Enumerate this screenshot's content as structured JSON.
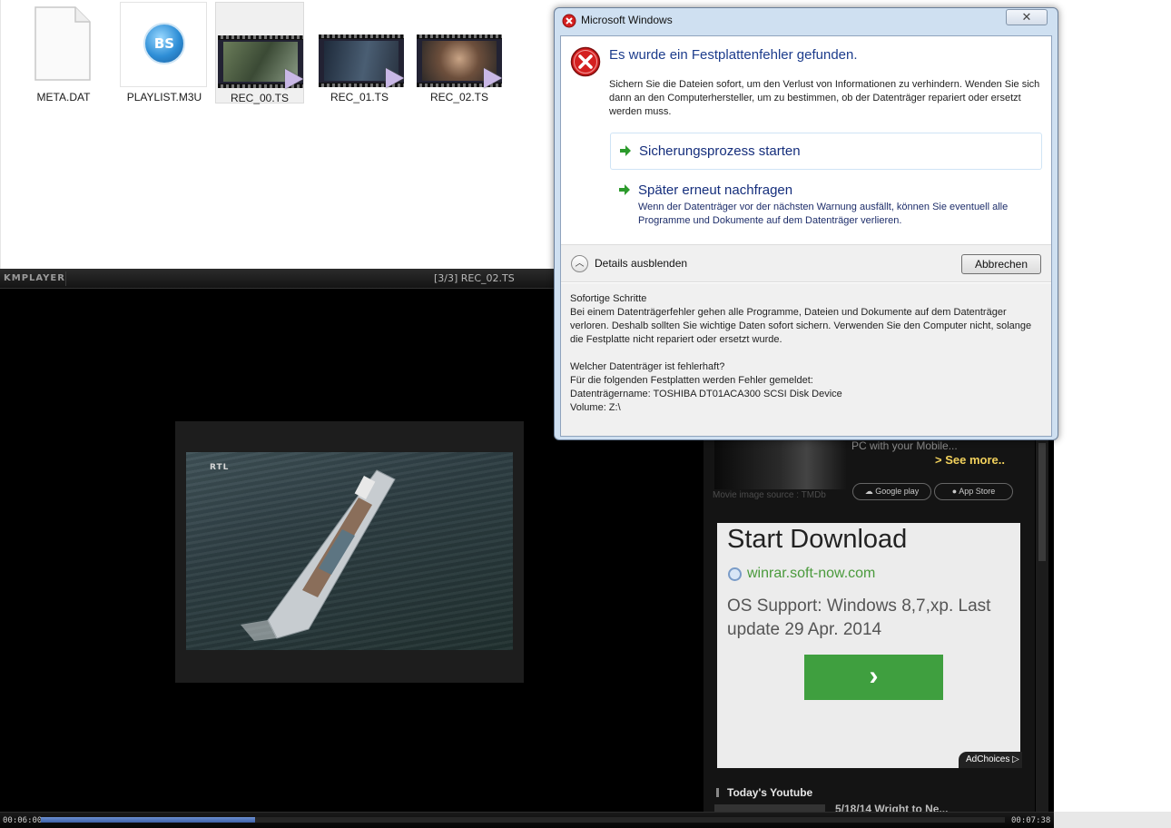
{
  "explorer": {
    "files": [
      {
        "name": "META.DAT",
        "icon": "document-icon",
        "selected": false
      },
      {
        "name": "PLAYLIST.M3U",
        "icon": "bs-player-icon",
        "selected": false
      },
      {
        "name": "REC_00.TS",
        "icon": "video-file-icon",
        "selected": true
      },
      {
        "name": "REC_01.TS",
        "icon": "video-file-icon",
        "selected": false
      },
      {
        "name": "REC_02.TS",
        "icon": "video-file-icon",
        "selected": false
      }
    ],
    "bs_icon_text": "BS"
  },
  "player": {
    "logo": "KMPLAYER",
    "now_playing": "[3/3] REC_02.TS",
    "video_watermark": "RTL",
    "time_elapsed": "00:06:00",
    "time_total": "00:07:38",
    "progress_fraction": 0.222
  },
  "ad_panel": {
    "promo_text": "PC with your Mobile...",
    "see_more": "> See more..",
    "movie_source": "Movie image source : TMDb",
    "google_play": "Google play",
    "app_store": "App Store",
    "ad": {
      "headline": "Start Download",
      "url": "winrar.soft-now.com",
      "description": "OS Support: Windows 8,7,xp. Last update 29 Apr. 2014",
      "button_glyph": "›",
      "adchoices": "AdChoices ▷"
    },
    "section_title": "Today's Youtube",
    "youtube_item": "5/18/14 Wright to Ne..."
  },
  "dialog": {
    "title": "Microsoft Windows",
    "close_glyph": "✕",
    "heading": "Es wurde ein Festplattenfehler gefunden.",
    "message": "Sichern Sie die Dateien sofort, um den Verlust von Informationen zu verhindern. Wenden Sie sich dann an den Computerhersteller, um zu bestimmen, ob der Datenträger repariert oder ersetzt werden muss.",
    "command_backup": "Sicherungsprozess starten",
    "command_later": "Später erneut nachfragen",
    "command_later_sub": "Wenn der Datenträger vor der nächsten Warnung ausfällt, können Sie eventuell alle Programme und Dokumente auf dem Datenträger verlieren.",
    "details_toggle": "Details ausblenden",
    "cancel": "Abbrechen",
    "details_lines": [
      "Sofortige Schritte",
      "Bei einem Datenträgerfehler gehen alle Programme, Dateien und Dokumente auf dem Datenträger verloren. Deshalb sollten Sie wichtige Daten sofort sichern. Verwenden Sie den Computer nicht, solange die Festplatte nicht repariert oder ersetzt wurde.",
      "",
      "Welcher Datenträger ist fehlerhaft?",
      "Für die folgenden Festplatten werden Fehler gemeldet:",
      "Datenträgername: TOSHIBA DT01ACA300 SCSI Disk Device",
      "Volume: Z:\\"
    ],
    "colors": {
      "heading": "#1c3c8c",
      "error_red": "#d42020",
      "arrow_green": "#2c9a2c"
    }
  }
}
